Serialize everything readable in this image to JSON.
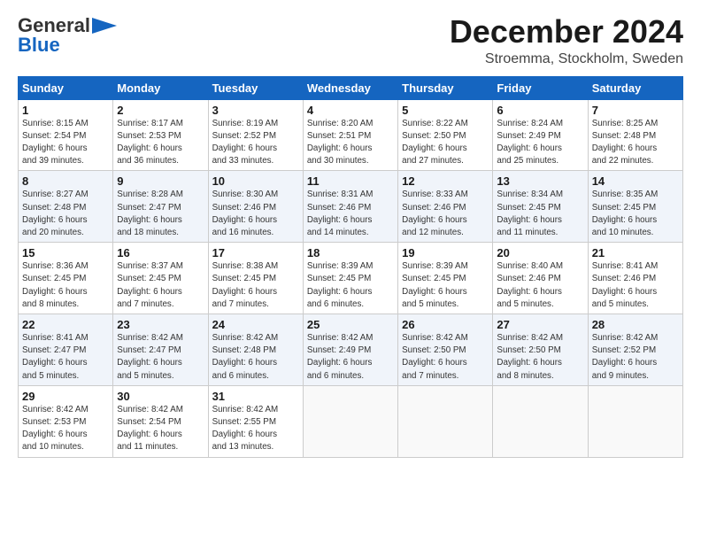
{
  "header": {
    "logo_general": "General",
    "logo_blue": "Blue",
    "month_title": "December 2024",
    "location": "Stroemma, Stockholm, Sweden"
  },
  "days_of_week": [
    "Sunday",
    "Monday",
    "Tuesday",
    "Wednesday",
    "Thursday",
    "Friday",
    "Saturday"
  ],
  "weeks": [
    [
      {
        "day": "1",
        "info": "Sunrise: 8:15 AM\nSunset: 2:54 PM\nDaylight: 6 hours\nand 39 minutes."
      },
      {
        "day": "2",
        "info": "Sunrise: 8:17 AM\nSunset: 2:53 PM\nDaylight: 6 hours\nand 36 minutes."
      },
      {
        "day": "3",
        "info": "Sunrise: 8:19 AM\nSunset: 2:52 PM\nDaylight: 6 hours\nand 33 minutes."
      },
      {
        "day": "4",
        "info": "Sunrise: 8:20 AM\nSunset: 2:51 PM\nDaylight: 6 hours\nand 30 minutes."
      },
      {
        "day": "5",
        "info": "Sunrise: 8:22 AM\nSunset: 2:50 PM\nDaylight: 6 hours\nand 27 minutes."
      },
      {
        "day": "6",
        "info": "Sunrise: 8:24 AM\nSunset: 2:49 PM\nDaylight: 6 hours\nand 25 minutes."
      },
      {
        "day": "7",
        "info": "Sunrise: 8:25 AM\nSunset: 2:48 PM\nDaylight: 6 hours\nand 22 minutes."
      }
    ],
    [
      {
        "day": "8",
        "info": "Sunrise: 8:27 AM\nSunset: 2:48 PM\nDaylight: 6 hours\nand 20 minutes."
      },
      {
        "day": "9",
        "info": "Sunrise: 8:28 AM\nSunset: 2:47 PM\nDaylight: 6 hours\nand 18 minutes."
      },
      {
        "day": "10",
        "info": "Sunrise: 8:30 AM\nSunset: 2:46 PM\nDaylight: 6 hours\nand 16 minutes."
      },
      {
        "day": "11",
        "info": "Sunrise: 8:31 AM\nSunset: 2:46 PM\nDaylight: 6 hours\nand 14 minutes."
      },
      {
        "day": "12",
        "info": "Sunrise: 8:33 AM\nSunset: 2:46 PM\nDaylight: 6 hours\nand 12 minutes."
      },
      {
        "day": "13",
        "info": "Sunrise: 8:34 AM\nSunset: 2:45 PM\nDaylight: 6 hours\nand 11 minutes."
      },
      {
        "day": "14",
        "info": "Sunrise: 8:35 AM\nSunset: 2:45 PM\nDaylight: 6 hours\nand 10 minutes."
      }
    ],
    [
      {
        "day": "15",
        "info": "Sunrise: 8:36 AM\nSunset: 2:45 PM\nDaylight: 6 hours\nand 8 minutes."
      },
      {
        "day": "16",
        "info": "Sunrise: 8:37 AM\nSunset: 2:45 PM\nDaylight: 6 hours\nand 7 minutes."
      },
      {
        "day": "17",
        "info": "Sunrise: 8:38 AM\nSunset: 2:45 PM\nDaylight: 6 hours\nand 7 minutes."
      },
      {
        "day": "18",
        "info": "Sunrise: 8:39 AM\nSunset: 2:45 PM\nDaylight: 6 hours\nand 6 minutes."
      },
      {
        "day": "19",
        "info": "Sunrise: 8:39 AM\nSunset: 2:45 PM\nDaylight: 6 hours\nand 5 minutes."
      },
      {
        "day": "20",
        "info": "Sunrise: 8:40 AM\nSunset: 2:46 PM\nDaylight: 6 hours\nand 5 minutes."
      },
      {
        "day": "21",
        "info": "Sunrise: 8:41 AM\nSunset: 2:46 PM\nDaylight: 6 hours\nand 5 minutes."
      }
    ],
    [
      {
        "day": "22",
        "info": "Sunrise: 8:41 AM\nSunset: 2:47 PM\nDaylight: 6 hours\nand 5 minutes."
      },
      {
        "day": "23",
        "info": "Sunrise: 8:42 AM\nSunset: 2:47 PM\nDaylight: 6 hours\nand 5 minutes."
      },
      {
        "day": "24",
        "info": "Sunrise: 8:42 AM\nSunset: 2:48 PM\nDaylight: 6 hours\nand 6 minutes."
      },
      {
        "day": "25",
        "info": "Sunrise: 8:42 AM\nSunset: 2:49 PM\nDaylight: 6 hours\nand 6 minutes."
      },
      {
        "day": "26",
        "info": "Sunrise: 8:42 AM\nSunset: 2:50 PM\nDaylight: 6 hours\nand 7 minutes."
      },
      {
        "day": "27",
        "info": "Sunrise: 8:42 AM\nSunset: 2:50 PM\nDaylight: 6 hours\nand 8 minutes."
      },
      {
        "day": "28",
        "info": "Sunrise: 8:42 AM\nSunset: 2:52 PM\nDaylight: 6 hours\nand 9 minutes."
      }
    ],
    [
      {
        "day": "29",
        "info": "Sunrise: 8:42 AM\nSunset: 2:53 PM\nDaylight: 6 hours\nand 10 minutes."
      },
      {
        "day": "30",
        "info": "Sunrise: 8:42 AM\nSunset: 2:54 PM\nDaylight: 6 hours\nand 11 minutes."
      },
      {
        "day": "31",
        "info": "Sunrise: 8:42 AM\nSunset: 2:55 PM\nDaylight: 6 hours\nand 13 minutes."
      },
      {
        "day": "",
        "info": ""
      },
      {
        "day": "",
        "info": ""
      },
      {
        "day": "",
        "info": ""
      },
      {
        "day": "",
        "info": ""
      }
    ]
  ]
}
